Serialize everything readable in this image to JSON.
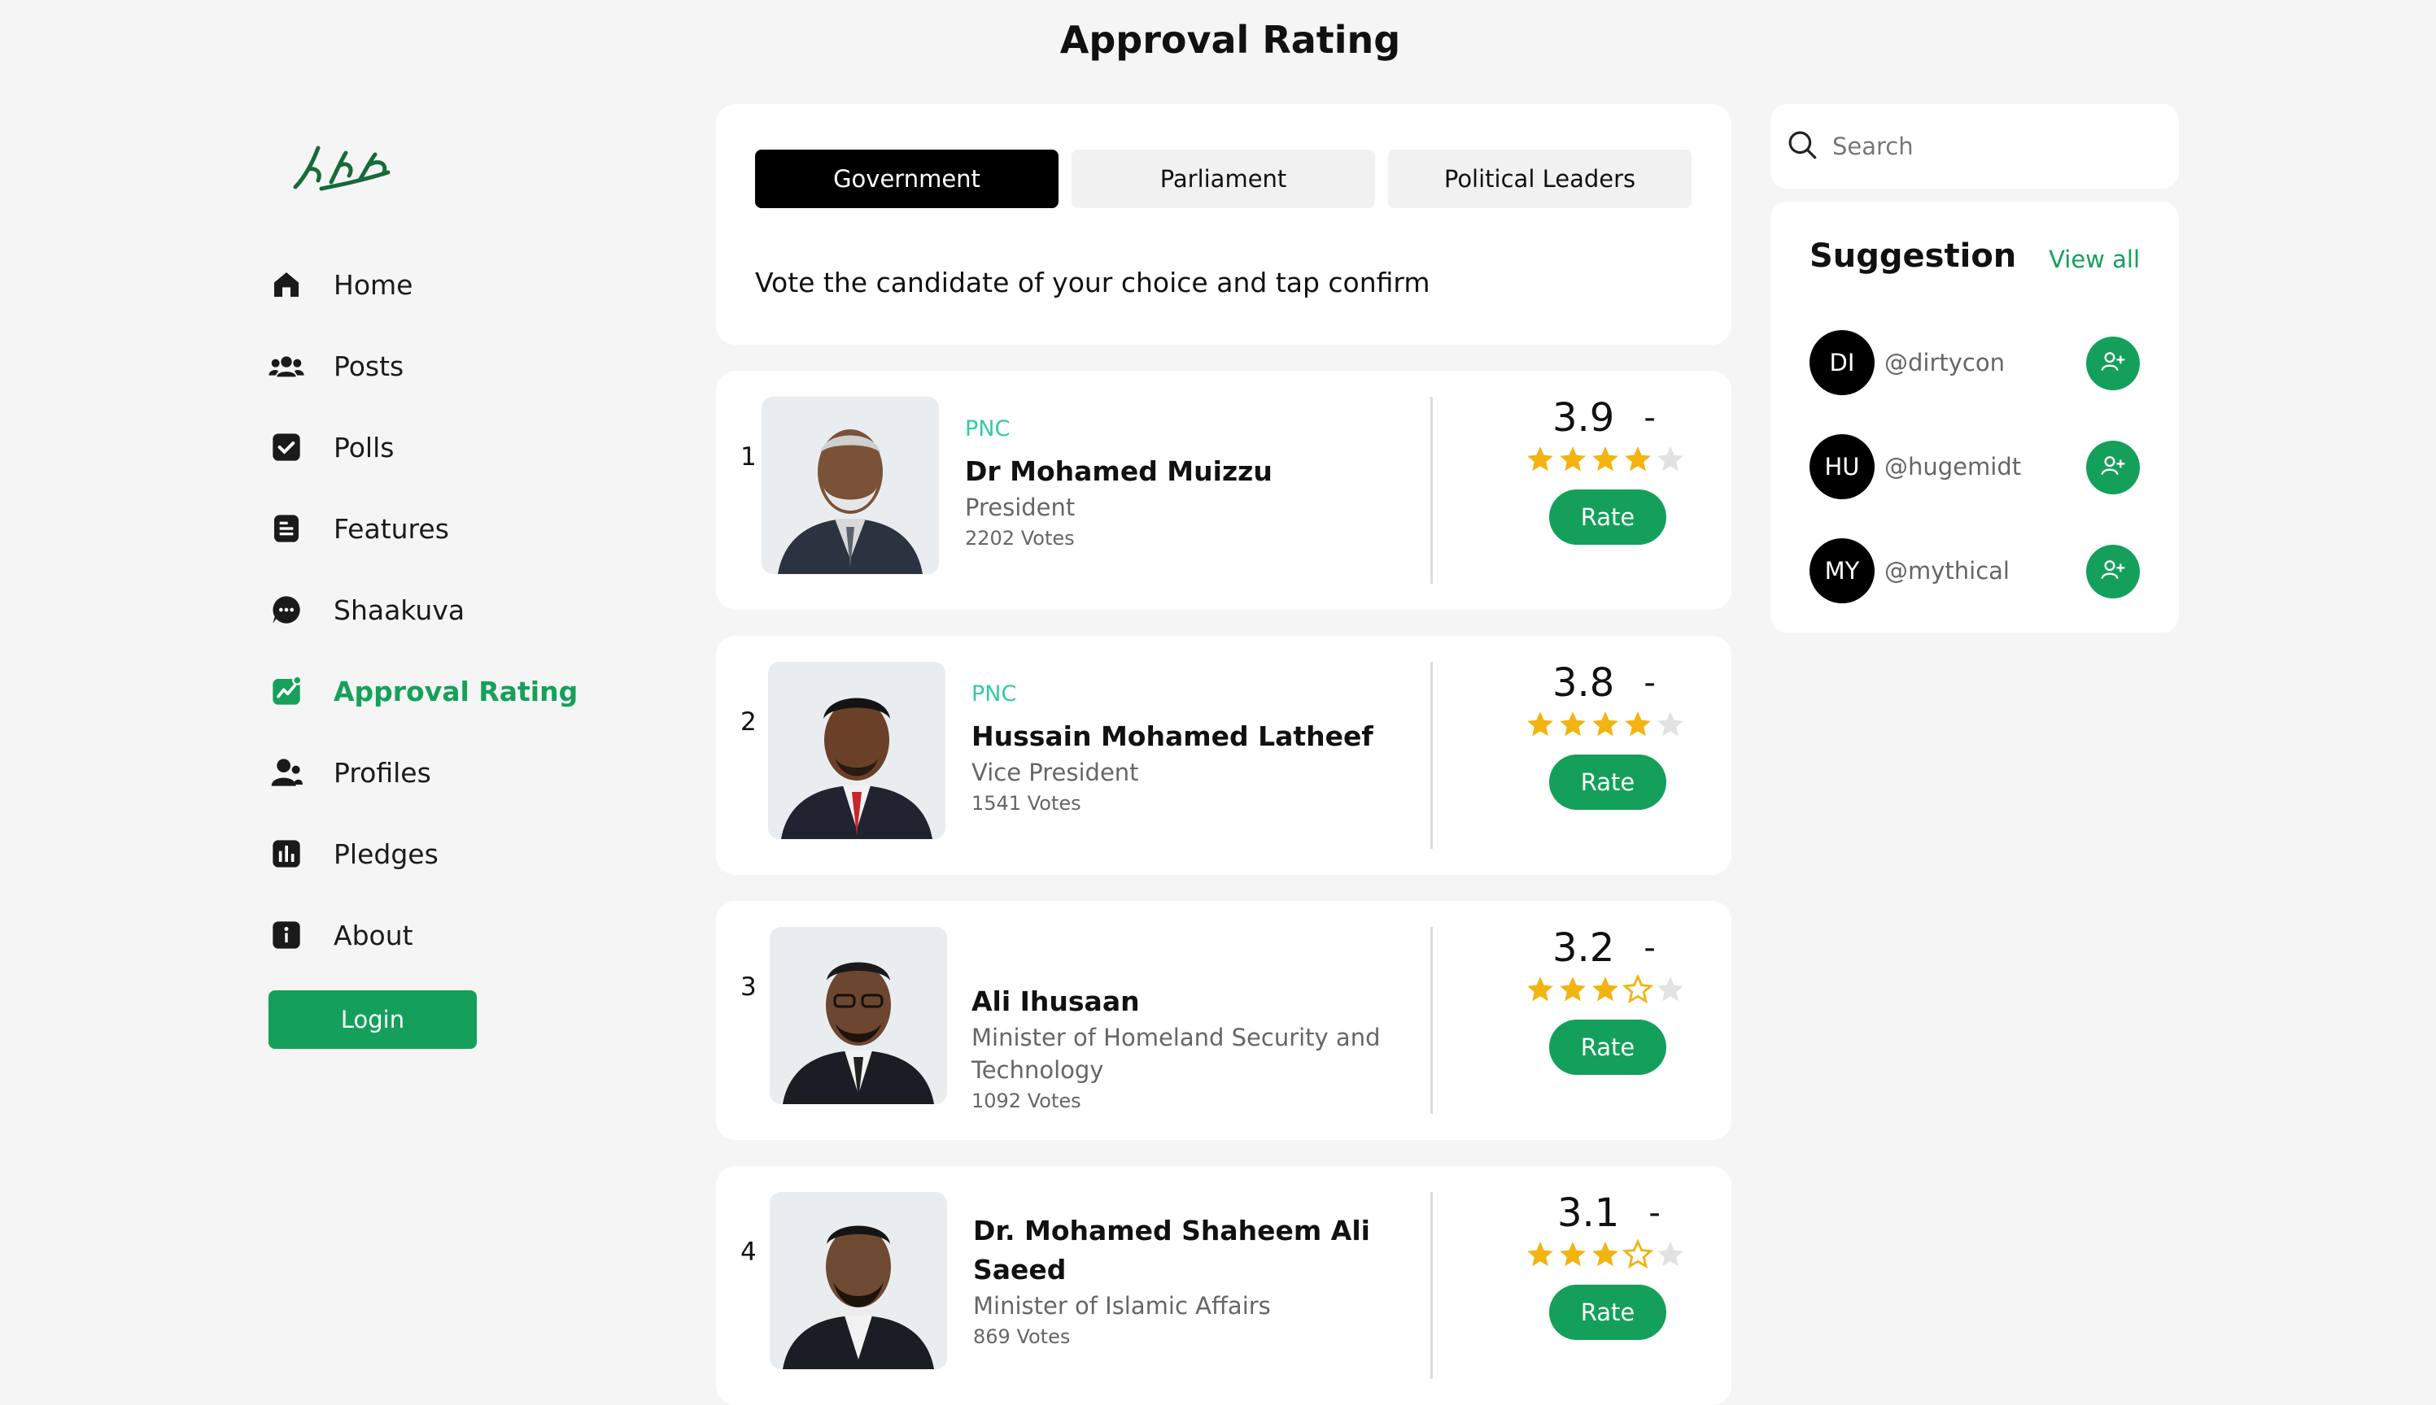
{
  "header": {
    "title": "Approval Rating"
  },
  "sidebar": {
    "items": [
      {
        "label": "Home",
        "icon": "home-icon"
      },
      {
        "label": "Posts",
        "icon": "users-icon"
      },
      {
        "label": "Polls",
        "icon": "check-square-icon"
      },
      {
        "label": "Features",
        "icon": "document-icon"
      },
      {
        "label": "Shaakuva",
        "icon": "chat-bubble-icon"
      },
      {
        "label": "Approval Rating",
        "icon": "trend-chart-icon",
        "active": true
      },
      {
        "label": "Profiles",
        "icon": "profile-icon"
      },
      {
        "label": "Pledges",
        "icon": "bar-chart-icon"
      },
      {
        "label": "About",
        "icon": "info-icon"
      }
    ],
    "login_label": "Login"
  },
  "main": {
    "tabs": [
      {
        "label": "Government",
        "active": true
      },
      {
        "label": "Parliament",
        "active": false
      },
      {
        "label": "Political Leaders",
        "active": false
      }
    ],
    "instruction": "Vote the candidate of your choice and tap confirm",
    "candidates": [
      {
        "rank": "1",
        "party": "PNC",
        "name": "Dr Mohamed Muizzu",
        "role": "President",
        "votes": "2202 Votes",
        "score": "3.9",
        "dash": "-",
        "stars_filled": 4,
        "rate_label": "Rate"
      },
      {
        "rank": "2",
        "party": "PNC",
        "name": "Hussain Mohamed Latheef",
        "role": "Vice President",
        "votes": "1541 Votes",
        "score": "3.8",
        "dash": "-",
        "stars_filled": 4,
        "rate_label": "Rate"
      },
      {
        "rank": "3",
        "party": "",
        "name": "Ali Ihusaan",
        "role": "Minister of Homeland Security and Technology",
        "votes": "1092 Votes",
        "score": "3.2",
        "dash": "-",
        "stars_filled": 3,
        "rate_label": "Rate"
      },
      {
        "rank": "4",
        "party": "",
        "name": "Dr. Mohamed Shaheem Ali Saeed",
        "role": "Minister of Islamic Affairs",
        "votes": "869 Votes",
        "score": "3.1",
        "dash": "-",
        "stars_filled": 3,
        "rate_label": "Rate"
      }
    ]
  },
  "search": {
    "placeholder": "Search"
  },
  "suggestions": {
    "title": "Suggestion",
    "view_all": "View all",
    "users": [
      {
        "initials": "DI",
        "handle": "@dirtycon"
      },
      {
        "initials": "HU",
        "handle": "@hugemidt"
      },
      {
        "initials": "MY",
        "handle": "@mythical"
      }
    ]
  },
  "colors": {
    "accent": "#14a05a",
    "party": "#33c9a8",
    "star": "#f2b411"
  }
}
